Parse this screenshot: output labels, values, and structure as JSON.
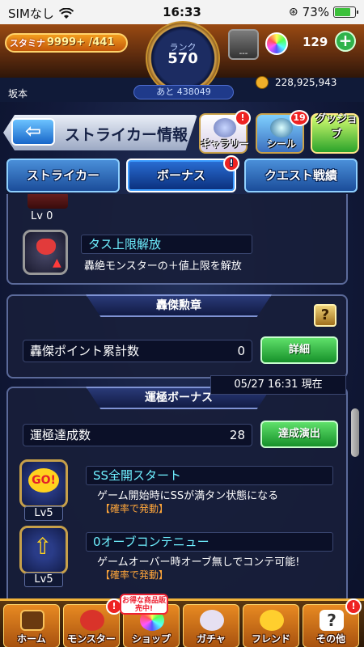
{
  "status_bar": {
    "carrier": "SIMなし",
    "time": "16:33",
    "battery": "73%"
  },
  "header": {
    "stamina_label": "スタミナ",
    "stamina_value": "9999+ /441",
    "rank_label": "ランク",
    "rank_value": "570",
    "rank_remaining": "あと 438049",
    "badge_text": "---",
    "orb_count": "129",
    "username": "坂本",
    "coins": "228,925,943"
  },
  "title_bar": {
    "title": "ストライカー情報",
    "gallery_label": "ギャラリー",
    "seal_label": "シール",
    "seal_badge": "19",
    "goods_label": "グッジョブ",
    "alert": "!"
  },
  "tabs": [
    {
      "label": "ストライカー",
      "active": false
    },
    {
      "label": "ボーナス",
      "active": true
    },
    {
      "label": "クエスト戦績",
      "active": false
    }
  ],
  "section1": {
    "lv_label": "Lv 0",
    "skill_name": "タス上限解放",
    "skill_desc": "轟絶モンスターの＋値上限を解放"
  },
  "section2": {
    "title": "轟傑勲章",
    "help": "?",
    "row_label": "轟傑ポイント累計数",
    "row_value": "0",
    "button": "詳細"
  },
  "section3": {
    "title": "運極ボーナス",
    "row_label": "運極達成数",
    "row_value": "28",
    "button": "達成演出",
    "skills": [
      {
        "level": "Lv5",
        "name": "SS全開スタート",
        "desc": "ゲーム開始時にSSが満タン状態になる",
        "note": "【確率で発動】"
      },
      {
        "level": "Lv5",
        "name": "0オーブコンテニュー",
        "desc": "ゲームオーバー時オーブ無しでコンテ可能!",
        "note": "【確率で発動】"
      }
    ],
    "timestamp": "05/27 16:31 現在"
  },
  "bottom_nav": {
    "promo": "お得な商品販売中!",
    "items": [
      "ホーム",
      "モンスター",
      "ショップ",
      "ガチャ",
      "フレンド",
      "その他"
    ]
  },
  "colors": {
    "accent_orange": "#f2b33a",
    "tab_blue": "#1b4d9a",
    "green_button": "#16912a",
    "skill_name": "#6ff0ff",
    "note_orange": "#ffa63a"
  },
  "icons": [
    "wifi-icon",
    "battery-icon",
    "back-arrow-icon",
    "orb-icon",
    "plus-icon",
    "coin-icon",
    "help-icon"
  ]
}
